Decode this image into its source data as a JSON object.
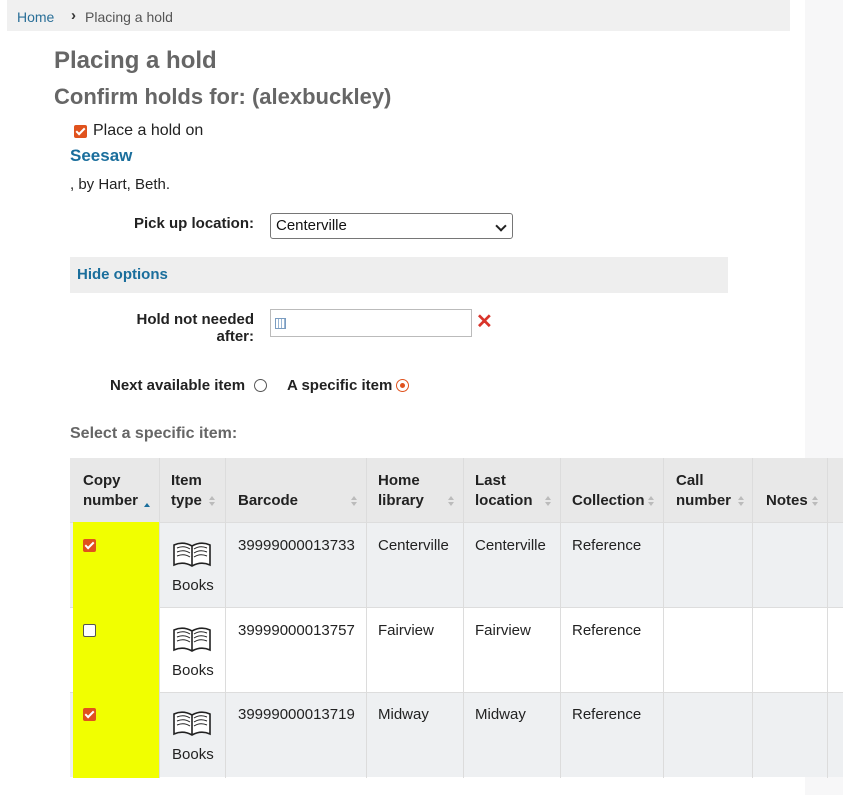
{
  "breadcrumb": {
    "home": "Home",
    "separator": "›",
    "current": "Placing a hold"
  },
  "page_title": "Placing a hold",
  "subtitle": "Confirm holds for: (alexbuckley)",
  "hold": {
    "place_label": "Place a hold on",
    "place_checked": true,
    "book_title": "Seesaw",
    "author_line": ", by Hart, Beth."
  },
  "pickup": {
    "label": "Pick up location:",
    "value": "Centerville"
  },
  "options_toggle": "Hide options",
  "not_needed": {
    "label_line1": "Hold not needed",
    "label_line2": "after:",
    "value": "",
    "clear_icon": "close-icon"
  },
  "radio": {
    "next_label": "Next available item",
    "next_selected": false,
    "specific_label": "A specific item",
    "specific_selected": true
  },
  "select_heading": "Select a specific item:",
  "table": {
    "headers": [
      {
        "line1": "Copy",
        "line2": "number"
      },
      {
        "line1": "Item",
        "line2": "type"
      },
      {
        "line1": "",
        "line2": "Barcode"
      },
      {
        "line1": "Home",
        "line2": "library"
      },
      {
        "line1": "Last",
        "line2": "location"
      },
      {
        "line1": "",
        "line2": "Collection"
      },
      {
        "line1": "Call",
        "line2": "number"
      },
      {
        "line1": "",
        "line2": "Notes"
      }
    ],
    "sorted_column": "Copy number",
    "rows": [
      {
        "checked": true,
        "item_type": "Books",
        "barcode": "39999000013733",
        "home_library": "Centerville",
        "last_location": "Centerville",
        "collection": "Reference",
        "call_number": "",
        "notes": ""
      },
      {
        "checked": false,
        "item_type": "Books",
        "barcode": "39999000013757",
        "home_library": "Fairview",
        "last_location": "Fairview",
        "collection": "Reference",
        "call_number": "",
        "notes": ""
      },
      {
        "checked": true,
        "item_type": "Books",
        "barcode": "39999000013719",
        "home_library": "Midway",
        "last_location": "Midway",
        "collection": "Reference",
        "call_number": "",
        "notes": ""
      }
    ]
  },
  "colors": {
    "accent": "#e0521d",
    "link": "#1a6e9c",
    "highlight": "#f1ff00"
  }
}
